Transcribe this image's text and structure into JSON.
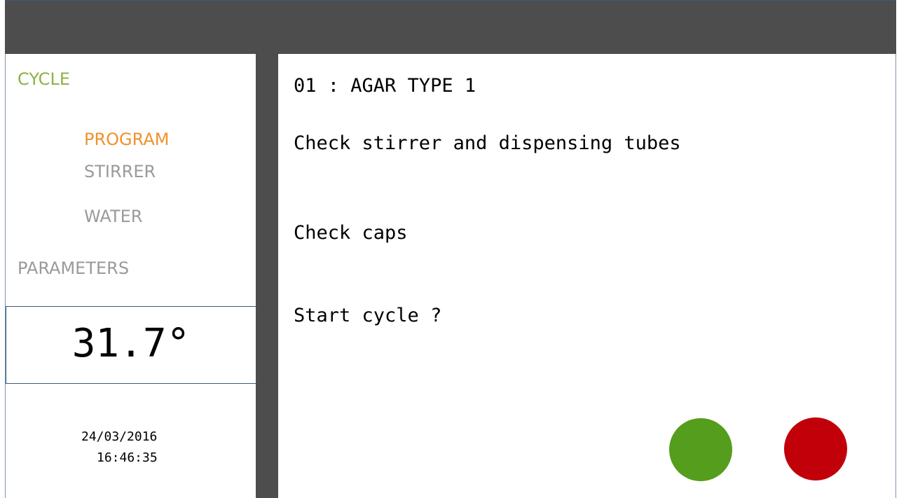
{
  "sidebar": {
    "cycle_label": "CYCLE",
    "program_label": "PROGRAM",
    "stirrer_label": "STIRRER",
    "water_label": "WATER",
    "parameters_label": "PARAMETERS",
    "temperature": "31.7°",
    "date": "24/03/2016",
    "time": "16:46:35"
  },
  "main": {
    "program_title": "01 : AGAR TYPE 1",
    "line1": "Check stirrer and dispensing tubes",
    "line2": "Check caps",
    "prompt": "Start cycle ?"
  },
  "colors": {
    "cycle": "#8bb346",
    "program_active": "#f0922b",
    "inactive": "#9a9a9a",
    "confirm": "#559d1d",
    "cancel": "#c1000a",
    "bar": "#4d4d4d"
  }
}
